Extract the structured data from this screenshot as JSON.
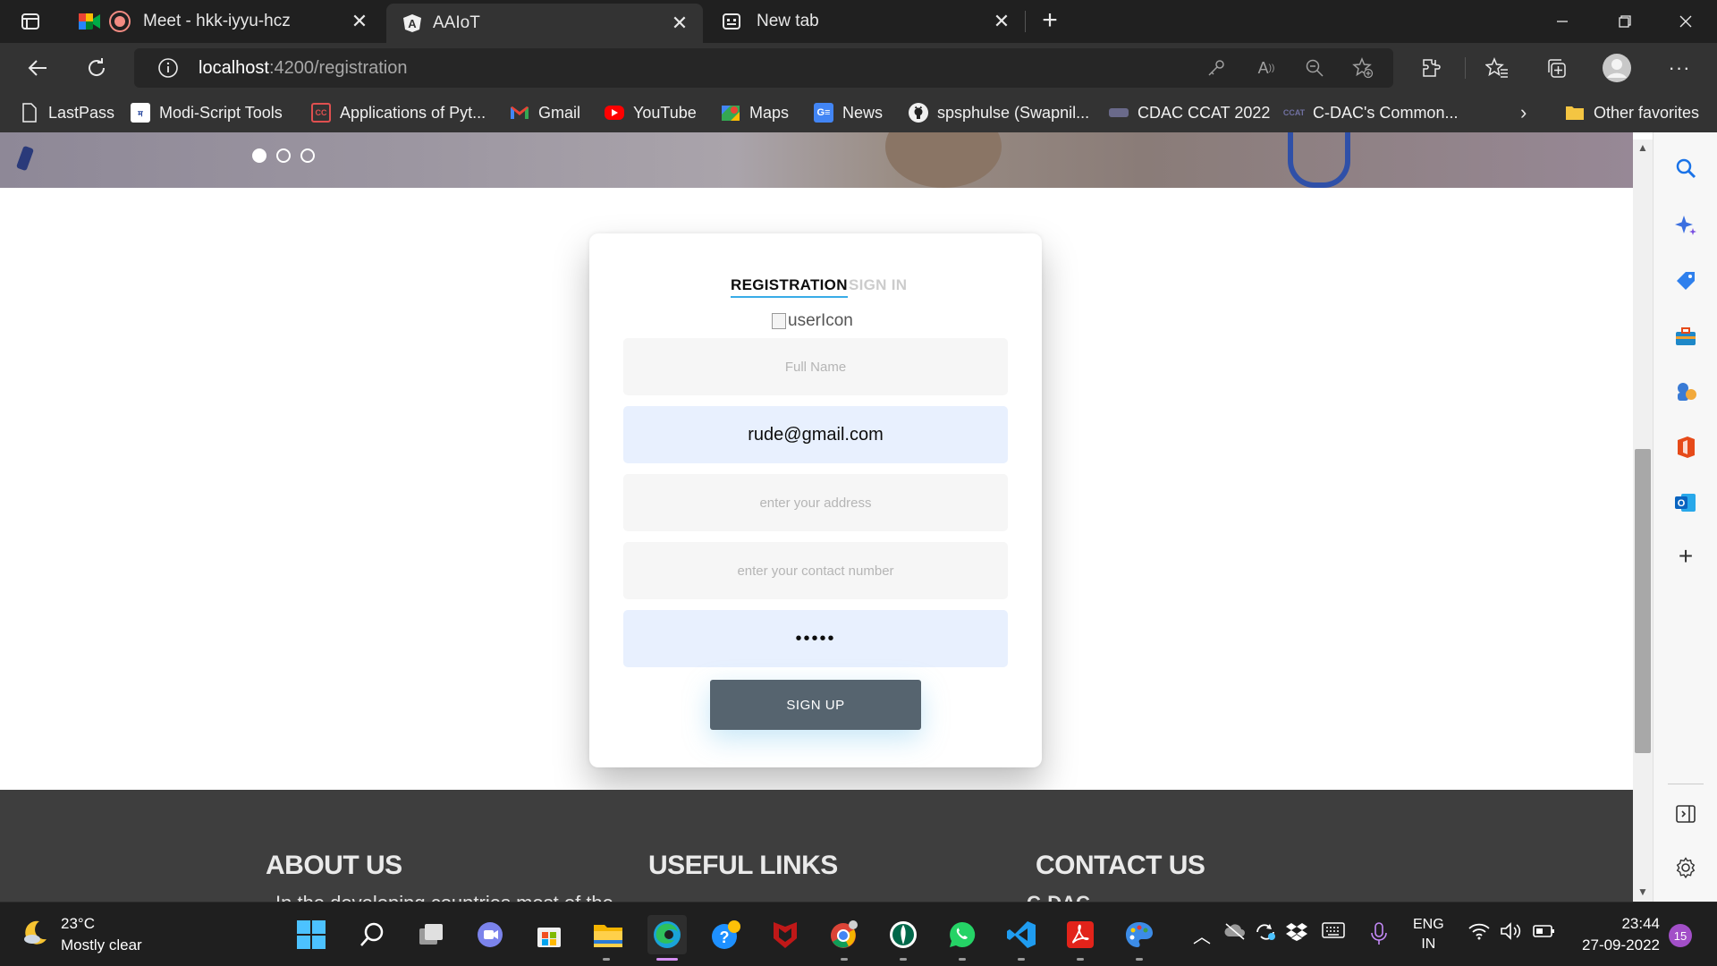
{
  "browser": {
    "tabs": [
      {
        "title": "Meet - hkk-iyyu-hcz",
        "icon": "google-meet-icon",
        "recording": true
      },
      {
        "title": "AAIoT",
        "icon": "angular-icon",
        "active": true
      },
      {
        "title": "New tab",
        "icon": "new-tab-icon"
      }
    ],
    "address": {
      "host": "localhost",
      "path": ":4200/registration"
    },
    "favorites": [
      {
        "label": "LastPass",
        "icon": "page-icon"
      },
      {
        "label": "Modi-Script Tools",
        "icon": "modi-icon"
      },
      {
        "label": "Applications of Pyt...",
        "icon": "cc-icon"
      },
      {
        "label": "Gmail",
        "icon": "gmail-icon"
      },
      {
        "label": "YouTube",
        "icon": "youtube-icon"
      },
      {
        "label": "Maps",
        "icon": "maps-icon"
      },
      {
        "label": "News",
        "icon": "google-news-icon"
      },
      {
        "label": "spsphulse (Swapnil...",
        "icon": "github-icon"
      },
      {
        "label": "CDAC CCAT 2022",
        "icon": "cdac-icon"
      },
      {
        "label": "C-DAC's Common...",
        "icon": "ccat-icon"
      }
    ],
    "other_favorites": "Other favorites"
  },
  "page": {
    "carousel": {
      "slides": 3,
      "active_index": 0
    },
    "form": {
      "tabs": [
        "REGISTRATION",
        "SIGN IN"
      ],
      "active_tab": "REGISTRATION",
      "user_icon_alt": "userIcon",
      "full_name": {
        "value": "",
        "placeholder": "Full Name"
      },
      "email": {
        "value": "rude@gmail.com",
        "placeholder": ""
      },
      "address": {
        "value": "",
        "placeholder": "enter your address"
      },
      "contact": {
        "value": "",
        "placeholder": "enter your contact number"
      },
      "password": {
        "value": "•••••",
        "placeholder": ""
      },
      "submit_label": "SIGN UP"
    },
    "footer": {
      "headings": [
        "ABOUT US",
        "USEFUL LINKS",
        "CONTACT US"
      ],
      "about_snippet": "In the developing countries most of the",
      "contact_snippet": "C-DAC"
    }
  },
  "taskbar": {
    "weather": {
      "temp": "23°C",
      "condition": "Mostly clear"
    },
    "language": {
      "lang": "ENG",
      "region": "IN"
    },
    "time": "23:44",
    "date": "27-09-2022",
    "notifications": "15"
  },
  "colors": {
    "tab_underline": "#39ace7",
    "button_bg": "#56646f",
    "autofill_bg": "#e8f0fe",
    "footer_bg": "#3e3e3e"
  }
}
